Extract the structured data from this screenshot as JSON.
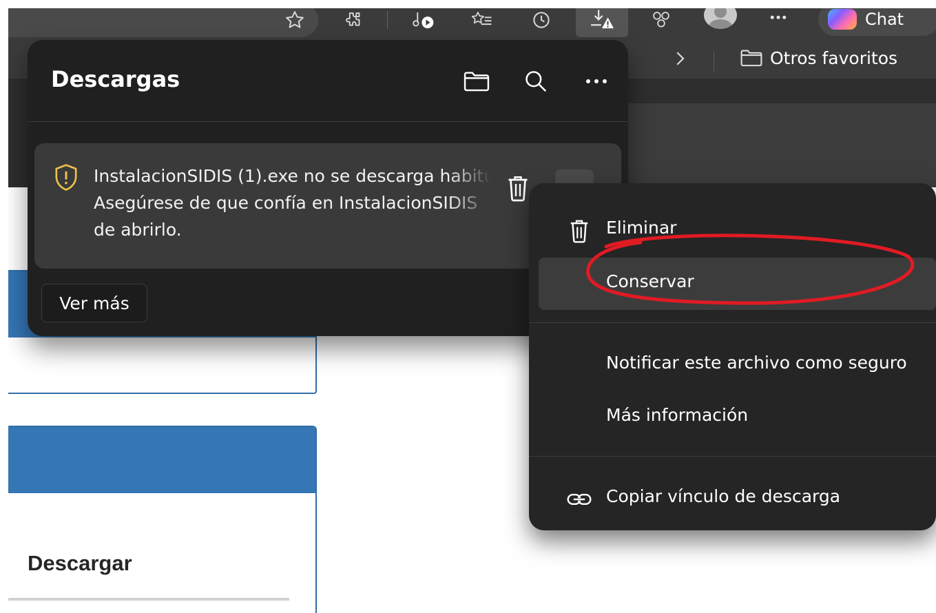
{
  "colors": {
    "flyout_bg": "#202020",
    "menu_bg": "#252525",
    "highlight_bg": "#3c3c3c",
    "warning_icon": "#f0c04a",
    "annotation_red": "#e01b24",
    "page_blue": "#3576b5"
  },
  "toolbar": {
    "icons": [
      "star-icon",
      "extensions-icon",
      "media-icon",
      "favorites-list-icon",
      "history-icon",
      "download-warning-icon",
      "copilot-icon",
      "profile-avatar",
      "more-icon"
    ],
    "chat_label": "Chat"
  },
  "favorites_bar": {
    "other_favorites": "Otros favoritos"
  },
  "downloads": {
    "title": "Descargas",
    "header_icons": [
      "folder-icon",
      "search-icon",
      "more-icon"
    ],
    "item": {
      "lines": [
        "InstalacionSIDIS (1).exe no se descarga habitu",
        "Asegúrese de que confía en InstalacionSIDIS",
        "de abrirlo."
      ],
      "icon": "shield-warning-icon"
    },
    "see_more": "Ver más"
  },
  "context_menu": {
    "items": [
      {
        "label": "Eliminar",
        "icon": "trash-icon"
      },
      {
        "label": "Conservar",
        "highlighted": true
      },
      {
        "label": "Notificar este archivo como seguro"
      },
      {
        "label": "Más información"
      },
      {
        "label": "Copiar vínculo de descarga",
        "icon": "link-icon"
      }
    ]
  },
  "page": {
    "section_title": "Descargar"
  }
}
